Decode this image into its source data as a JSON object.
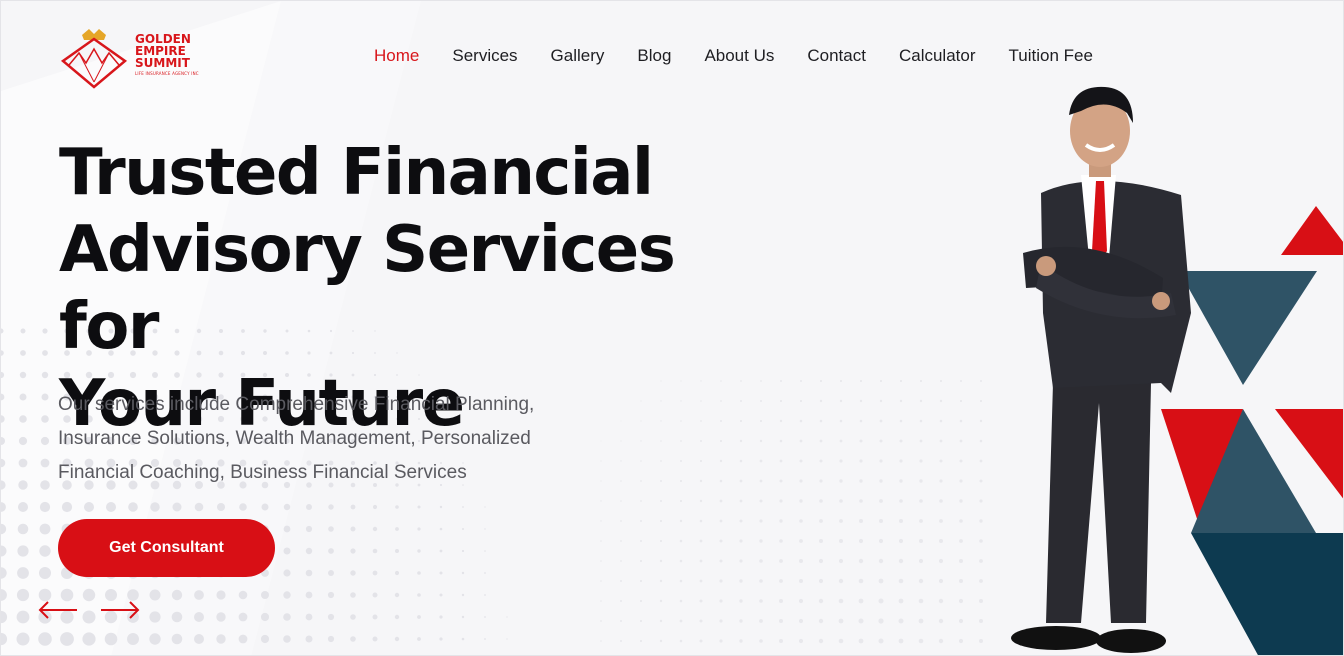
{
  "brand": {
    "line1": "GOLDEN",
    "line2": "EMPIRE",
    "line3": "SUMMIT",
    "tagline": "LIFE INSURANCE AGENCY INC",
    "logo_icon": "diamond-crown-logo-icon",
    "color": "#d8161b"
  },
  "nav": {
    "items": [
      {
        "label": "Home",
        "active": true
      },
      {
        "label": "Services"
      },
      {
        "label": "Gallery"
      },
      {
        "label": "Blog"
      },
      {
        "label": "About Us"
      },
      {
        "label": "Contact"
      },
      {
        "label": "Calculator"
      },
      {
        "label": "Tuition Fee"
      }
    ]
  },
  "hero": {
    "title_line1": "Trusted Financial",
    "title_line2": "Advisory Services for",
    "title_line3": "Your Future",
    "subtitle": "Our services include Comprehensive Financial Planning, Insurance Solutions, Wealth Management, Personalized Financial Coaching, Business Financial Services",
    "cta_label": "Get Consultant",
    "prev_icon": "arrow-left-icon",
    "next_icon": "arrow-right-icon"
  },
  "colors": {
    "accent": "#d80f15",
    "slate": "#2f5366",
    "navy": "#0d3a50",
    "text": "#0d0d10"
  }
}
